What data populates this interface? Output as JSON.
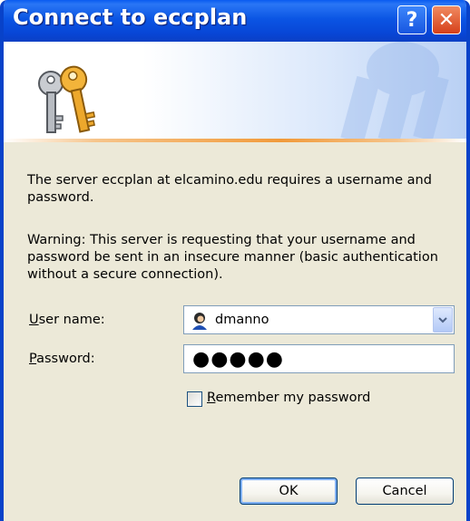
{
  "window": {
    "title": "Connect to eccplan",
    "help_glyph": "?",
    "close_glyph": "✕"
  },
  "icons": {
    "banner": "keys-icon",
    "user": "user-icon",
    "combo_arrow": "chevron-down-icon"
  },
  "message": {
    "line1": "The server eccplan at elcamino.edu requires a username and password.",
    "line2": "Warning: This server is requesting that your username and password be sent in an insecure manner (basic authentication without a secure connection)."
  },
  "form": {
    "username_label_accesskey": "U",
    "username_label_rest": "ser name:",
    "username_value": "dmanno",
    "password_label_accesskey": "P",
    "password_label_rest": "assword:",
    "password_value": "●●●●●",
    "remember_accesskey": "R",
    "remember_rest": "emember my password",
    "remember_checked": false
  },
  "buttons": {
    "ok": "OK",
    "cancel": "Cancel"
  },
  "colors": {
    "titlebar": "#0846d6",
    "window_border": "#0842c9",
    "dialog_bg": "#ece9d8",
    "accent_rule": "#f19a3a",
    "close_button": "#d6401a"
  }
}
